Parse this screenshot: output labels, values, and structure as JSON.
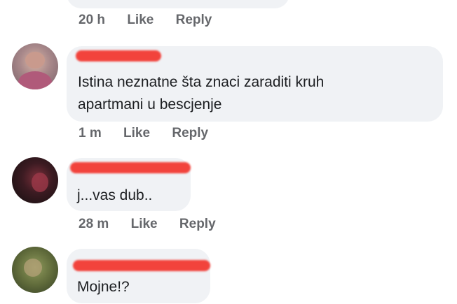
{
  "comments": [
    {
      "text_lines": [],
      "time": "20 h",
      "like_label": "Like",
      "reply_label": "Reply"
    },
    {
      "text_lines": [
        "Istina neznatne šta znaci zaraditi kruh",
        "apartmani u bescjenje"
      ],
      "time": "1 m",
      "like_label": "Like",
      "reply_label": "Reply"
    },
    {
      "text_lines": [
        "j...vas dub.."
      ],
      "time": "28 m",
      "like_label": "Like",
      "reply_label": "Reply"
    },
    {
      "text_lines": [
        "Mojne!?"
      ]
    }
  ],
  "colors": {
    "bubble": "#f0f2f5",
    "meta_text": "#65676b",
    "redaction": "#f2433c"
  }
}
